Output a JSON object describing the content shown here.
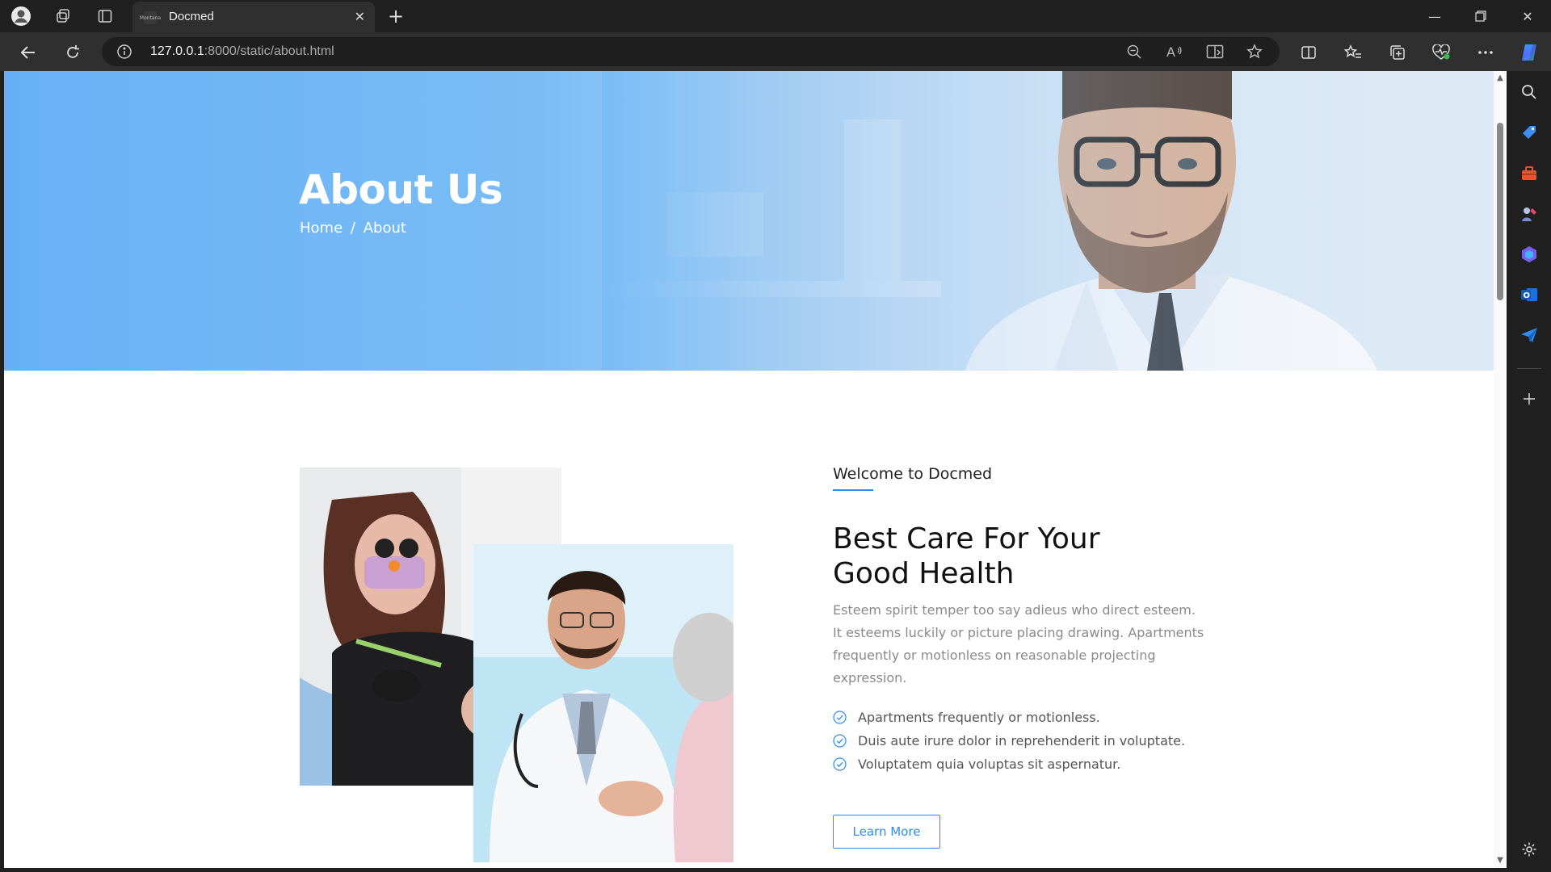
{
  "browser": {
    "tab_title": "Docmed",
    "tab_favicon_text": "Montana",
    "url_host": "127.0.0.1",
    "url_path": ":8000/static/about.html"
  },
  "hero": {
    "title": "About Us",
    "breadcrumb": [
      "Home",
      "/",
      "About"
    ]
  },
  "about": {
    "eyebrow": "Welcome to Docmed",
    "heading_line1": "Best Care For Your",
    "heading_line2": "Good Health",
    "description": "Esteem spirit temper too say adieus who direct esteem. It esteems luckily or picture placing drawing. Apartments frequently or motionless on reasonable projecting expression.",
    "features": [
      "Apartments frequently or motionless.",
      "Duis aute irure dolor in reprehenderit in voluptate.",
      "Voluptatem quia voluptas sit aspernatur."
    ],
    "button_label": "Learn More"
  },
  "colors": {
    "accent": "#2f8cf0",
    "hero_blue": "#66b1f5"
  }
}
